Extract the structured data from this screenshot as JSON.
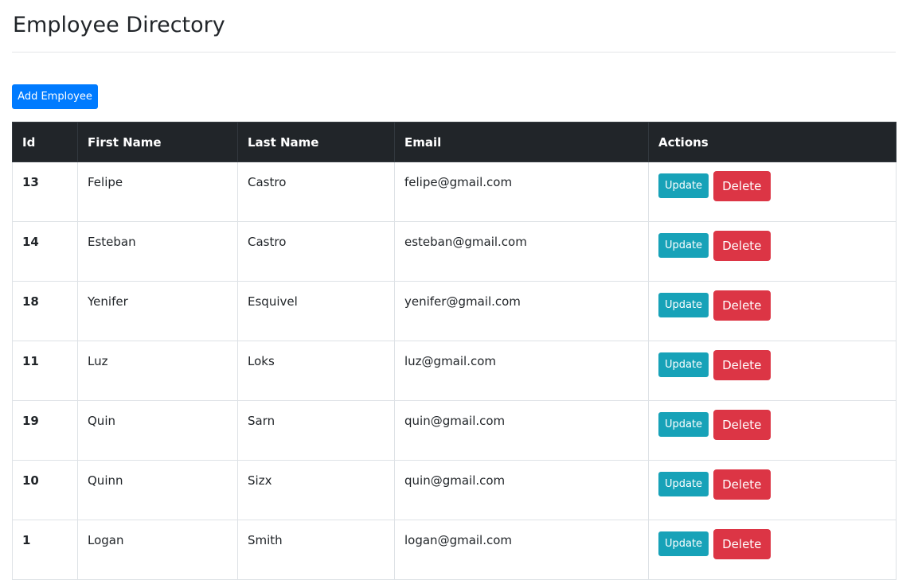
{
  "page": {
    "title": "Employee Directory"
  },
  "toolbar": {
    "add_label": "Add Employee"
  },
  "table": {
    "headers": {
      "id": "Id",
      "first": "First Name",
      "last": "Last Name",
      "email": "Email",
      "actions": "Actions"
    },
    "rows": [
      {
        "id": "13",
        "first": "Felipe",
        "last": "Castro",
        "email": "felipe@gmail.com"
      },
      {
        "id": "14",
        "first": "Esteban",
        "last": "Castro",
        "email": "esteban@gmail.com"
      },
      {
        "id": "18",
        "first": "Yenifer",
        "last": "Esquivel",
        "email": "yenifer@gmail.com"
      },
      {
        "id": "11",
        "first": "Luz",
        "last": "Loks",
        "email": "luz@gmail.com"
      },
      {
        "id": "19",
        "first": "Quin",
        "last": "Sarn",
        "email": "quin@gmail.com"
      },
      {
        "id": "10",
        "first": "Quinn",
        "last": "Sizx",
        "email": "quin@gmail.com"
      },
      {
        "id": "1",
        "first": "Logan",
        "last": "Smith",
        "email": "logan@gmail.com"
      }
    ],
    "update_label": "Update",
    "delete_label": "Delete"
  },
  "colors": {
    "primary": "#007bff",
    "info": "#17a2b8",
    "danger": "#dc3545",
    "header_bg": "#212529"
  }
}
